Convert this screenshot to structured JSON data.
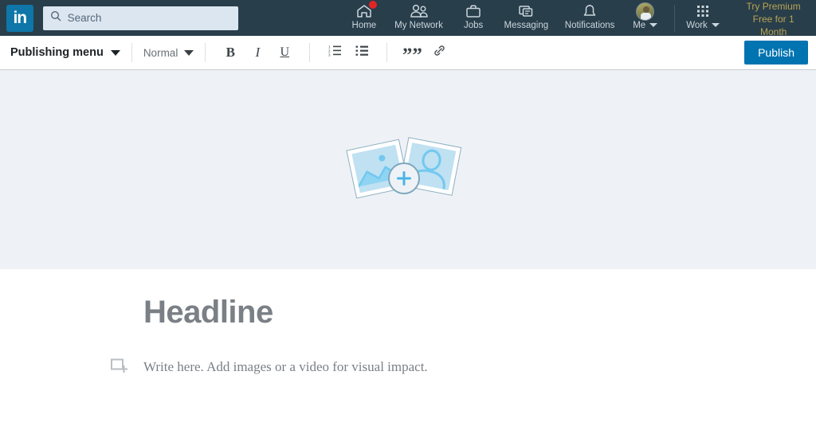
{
  "nav": {
    "logo_text": "in",
    "logo_name": "linkedin-logo",
    "search": {
      "placeholder": "Search",
      "value": "",
      "icon": "search-icon"
    },
    "items": [
      {
        "label": "Home",
        "icon": "home-icon",
        "badge": true
      },
      {
        "label": "My Network",
        "icon": "network-icon",
        "badge": false
      },
      {
        "label": "Jobs",
        "icon": "briefcase-icon",
        "badge": false
      },
      {
        "label": "Messaging",
        "icon": "messaging-icon",
        "badge": false
      },
      {
        "label": "Notifications",
        "icon": "bell-icon",
        "badge": false
      }
    ],
    "me": {
      "label": "Me",
      "icon": "avatar",
      "caret": "chevron-down-icon"
    },
    "work": {
      "label": "Work",
      "icon": "grid-icon",
      "caret": "chevron-down-icon"
    },
    "premium_line1": "Try Premium",
    "premium_line2": "Free for 1 Month",
    "bg_color": "#283e4a",
    "premium_color": "#b9a356",
    "badge_color": "#e12525"
  },
  "toolbar": {
    "publishing_menu": "Publishing menu",
    "style_value": "Normal",
    "bold": "B",
    "italic": "I",
    "underline": "U",
    "ordered_list_icon": "ordered-list-icon",
    "unordered_list_icon": "unordered-list-icon",
    "quote": "””",
    "link_icon": "link-icon",
    "publish_label": "Publish",
    "publish_color": "#0073b1"
  },
  "cover": {
    "placeholder_name": "cover-image-placeholder",
    "bg_color": "#eef2f6",
    "card_fill": "#bfe1f2",
    "card_stroke": "#8cadc0"
  },
  "editor": {
    "headline_placeholder": "Headline",
    "body_placeholder": "Write here. Add images or a video for visual impact.",
    "add_media_icon": "add-media-icon",
    "placeholder_color": "#7a8086"
  }
}
